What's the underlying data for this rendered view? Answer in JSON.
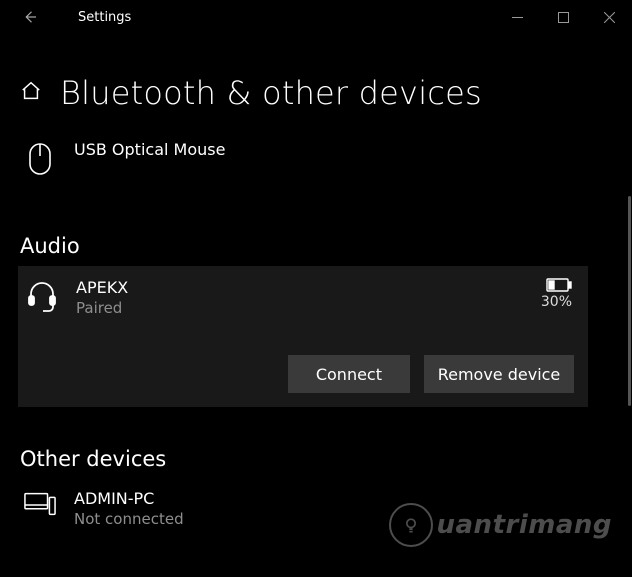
{
  "window": {
    "title": "Settings"
  },
  "page": {
    "title": "Bluetooth & other devices"
  },
  "mouse_device": {
    "name": "USB Optical Mouse"
  },
  "sections": {
    "audio": "Audio",
    "other": "Other devices"
  },
  "audio_device": {
    "name": "APEKX",
    "status": "Paired",
    "battery_pct": "30%",
    "actions": {
      "connect": "Connect",
      "remove": "Remove device"
    }
  },
  "other_device": {
    "name": "ADMIN-PC",
    "status": "Not connected"
  },
  "watermark": "uantrimang"
}
